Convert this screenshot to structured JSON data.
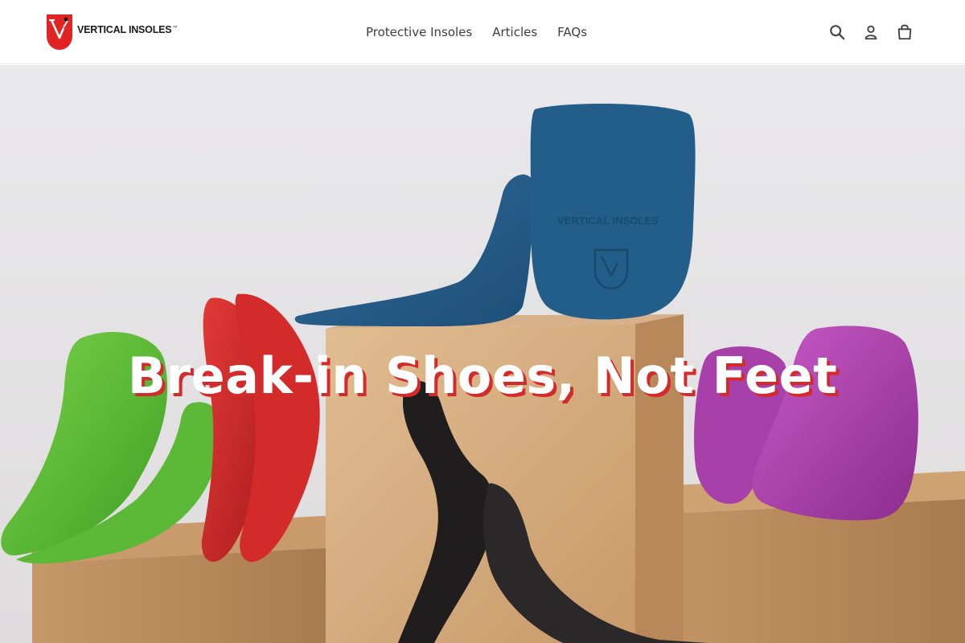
{
  "brand": {
    "name": "VERTICAL INSOLES",
    "trademark": "™",
    "logo_mark": "V",
    "color": "#e02424"
  },
  "nav": {
    "items": [
      "Protective Insoles",
      "Articles",
      "FAQs"
    ]
  },
  "header_icons": {
    "search": "search-icon",
    "account": "user-icon",
    "cart": "cart-icon"
  },
  "hero": {
    "heading": "Break-in Shoes, Not Feet",
    "product_embossed_brand": "VERTICAL INSOLES",
    "heading_shadow_color": "#d32b2b"
  }
}
